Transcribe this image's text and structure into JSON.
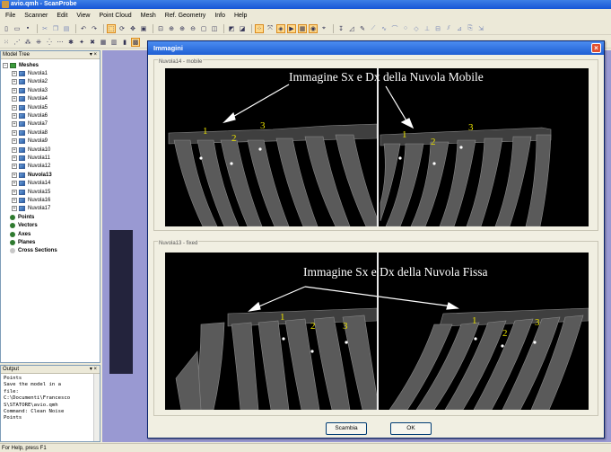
{
  "window": {
    "title": "avio.qmh - ScanProbe"
  },
  "menu": [
    "File",
    "Scanner",
    "Edit",
    "View",
    "Point Cloud",
    "Mesh",
    "Ref. Geometry",
    "Info",
    "Help"
  ],
  "model_tree": {
    "title": "Model Tree",
    "buttons": "▾ ×",
    "meshes_label": "Meshes",
    "nuvole": [
      "Nuvola1",
      "Nuvola2",
      "Nuvola3",
      "Nuvola4",
      "Nuvola5",
      "Nuvola6",
      "Nuvola7",
      "Nuvola8",
      "Nuvola9",
      "Nuvola10",
      "Nuvola11",
      "Nuvola12",
      "Nuvola13",
      "Nuvola14",
      "Nuvola15",
      "Nuvola16",
      "Nuvola17"
    ],
    "bold_item": "Nuvola13",
    "others": [
      "Points",
      "Vectors",
      "Axes",
      "Planes",
      "Cross Sections"
    ]
  },
  "output": {
    "title": "Output",
    "buttons": "▾ ×",
    "lines": [
      "Points",
      "Save the model in a",
      "file:",
      "C:\\Documenti\\Francesco",
      "S\\STATORE\\avio.qmh",
      "Command: Clean Noise",
      "Points"
    ]
  },
  "dialog": {
    "title": "Immagini",
    "close": "×",
    "group1": {
      "label": "Nuvola14 - mobile",
      "caption": "Immagine Sx e Dx della Nuvola Mobile",
      "numbers": [
        "1",
        "2",
        "3",
        "1",
        "2",
        "3"
      ]
    },
    "group2": {
      "label": "Nuvola13 - fixed",
      "caption": "Immagine Sx e Dx della Nuvola Fissa",
      "numbers": [
        "1",
        "2",
        "3",
        "1",
        "2",
        "3"
      ]
    },
    "button_swap": "Scambia",
    "button_ok": "OK"
  },
  "status": {
    "text": "For Help, press F1"
  },
  "colors": {
    "viewport": "#9999d2",
    "titlebar": "#1f5fd4",
    "numbers": "#e8e000"
  }
}
